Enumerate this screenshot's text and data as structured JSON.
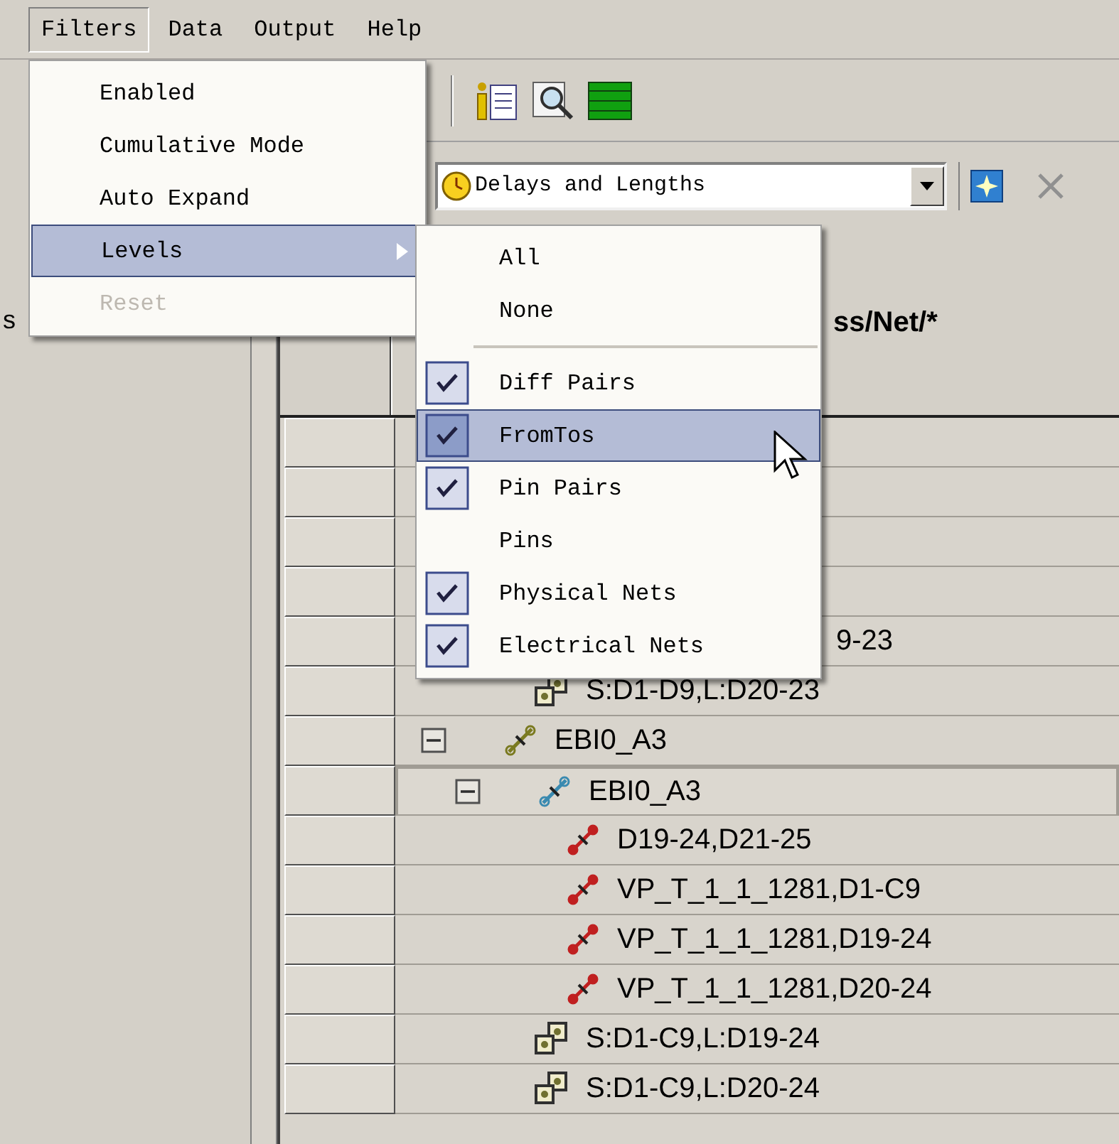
{
  "menubar": [
    {
      "label": "Filters",
      "selected": true
    },
    {
      "label": "Data",
      "selected": false
    },
    {
      "label": "Output",
      "selected": false
    },
    {
      "label": "Help",
      "selected": false
    }
  ],
  "left_panel": {
    "label": "s"
  },
  "filters_menu": [
    {
      "label": "Enabled",
      "selected": false,
      "disabled": false,
      "submenu": false
    },
    {
      "label": "Cumulative Mode",
      "selected": false,
      "disabled": false,
      "submenu": false
    },
    {
      "label": "Auto Expand",
      "selected": false,
      "disabled": false,
      "submenu": false
    },
    {
      "label": "Levels",
      "selected": true,
      "disabled": false,
      "submenu": true
    },
    {
      "label": "Reset",
      "selected": false,
      "disabled": true,
      "submenu": false
    }
  ],
  "levels_menu": [
    {
      "kind": "action",
      "label": "All",
      "selected": false
    },
    {
      "kind": "action",
      "label": "None",
      "selected": false
    },
    {
      "kind": "separator"
    },
    {
      "kind": "check",
      "label": "Diff Pairs",
      "checked": true,
      "selected": false
    },
    {
      "kind": "check",
      "label": "FromTos",
      "checked": true,
      "selected": true
    },
    {
      "kind": "check",
      "label": "Pin Pairs",
      "checked": true,
      "selected": false
    },
    {
      "kind": "check",
      "label": "Pins",
      "checked": false,
      "selected": false
    },
    {
      "kind": "check",
      "label": "Physical Nets",
      "checked": true,
      "selected": false
    },
    {
      "kind": "check",
      "label": "Electrical Nets",
      "checked": true,
      "selected": false
    }
  ],
  "view_select": {
    "value": "Delays and Lengths"
  },
  "grid": {
    "header": "ss/Net/*",
    "tree": [
      {
        "kind": "covered",
        "selected": false,
        "children": [
          {
            "kind": "covered",
            "selected": false
          },
          {
            "kind": "covered",
            "selected": false
          },
          {
            "kind": "covered",
            "selected": false
          },
          {
            "kind": "covered",
            "selected": false,
            "text": "9-23"
          },
          {
            "kind": "pin_pair",
            "selected": false,
            "text": "S:D1-D9,L:D20-23"
          }
        ]
      },
      {
        "kind": "xnet",
        "selected": false,
        "expanded": true,
        "text": "EBI0_A3",
        "children": [
          {
            "kind": "net",
            "selected": true,
            "expanded": true,
            "text": "EBI0_A3",
            "children": [
              {
                "kind": "from_to",
                "selected": false,
                "text": "D19-24,D21-25"
              },
              {
                "kind": "from_to",
                "selected": false,
                "text": "VP_T_1_1_1281,D1-C9"
              },
              {
                "kind": "from_to",
                "selected": false,
                "text": "VP_T_1_1_1281,D19-24"
              },
              {
                "kind": "from_to",
                "selected": false,
                "text": "VP_T_1_1_1281,D20-24"
              }
            ]
          },
          {
            "kind": "pin_pair",
            "selected": false,
            "text": "S:D1-C9,L:D19-24"
          },
          {
            "kind": "pin_pair",
            "selected": false,
            "text": "S:D1-C9,L:D20-24"
          }
        ]
      }
    ]
  }
}
